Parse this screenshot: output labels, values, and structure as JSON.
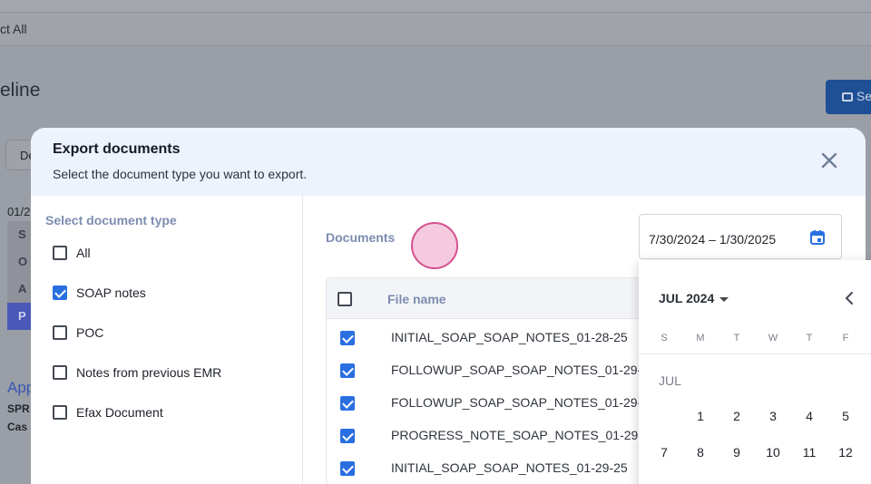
{
  "background": {
    "select_all": "ct All",
    "page_title": "eline",
    "action_button_label": "Se",
    "tab_label": "De",
    "date": "01/2",
    "soap_letters": [
      "S",
      "O",
      "A",
      "P"
    ],
    "section_title": "App",
    "line1": "SPR",
    "line2": "Cas"
  },
  "modal": {
    "title": "Export documents",
    "subtitle": "Select the document type you want to export.",
    "left": {
      "heading": "Select document type",
      "options": [
        {
          "label": "All",
          "checked": false
        },
        {
          "label": "SOAP notes",
          "checked": true
        },
        {
          "label": "POC",
          "checked": false
        },
        {
          "label": "Notes from previous EMR",
          "checked": false
        },
        {
          "label": "Efax Document",
          "checked": false
        }
      ]
    },
    "documents_label": "Documents",
    "date_range": "7/30/2024 – 1/30/2025",
    "table": {
      "header": "File name",
      "rows": [
        {
          "name": "INITIAL_SOAP_SOAP_NOTES_01-28-25",
          "checked": true
        },
        {
          "name": "FOLLOWUP_SOAP_SOAP_NOTES_01-29-",
          "checked": true
        },
        {
          "name": "FOLLOWUP_SOAP_SOAP_NOTES_01-29-",
          "checked": true
        },
        {
          "name": "PROGRESS_NOTE_SOAP_NOTES_01-29-",
          "checked": true
        },
        {
          "name": "INITIAL_SOAP_SOAP_NOTES_01-29-25",
          "checked": true
        }
      ]
    },
    "calendar": {
      "month_year": "JUL 2024",
      "weekdays": [
        "S",
        "M",
        "T",
        "W",
        "T",
        "F"
      ],
      "month_label": "JUL",
      "week1": [
        "1",
        "2",
        "3",
        "4",
        "5"
      ],
      "week2": [
        "7",
        "8",
        "9",
        "10",
        "11",
        "12"
      ]
    }
  },
  "colors": {
    "accent": "#2a6fe0",
    "header_bg": "#eef2fd",
    "muted_label": "#7d8cb0"
  }
}
